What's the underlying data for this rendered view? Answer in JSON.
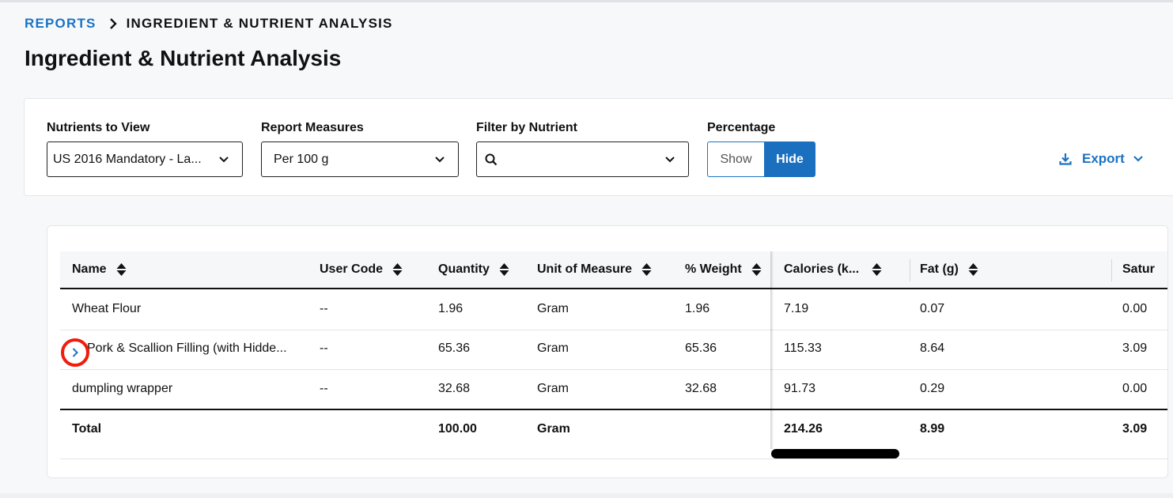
{
  "breadcrumb": {
    "root": "REPORTS",
    "current": "INGREDIENT & NUTRIENT ANALYSIS"
  },
  "page": {
    "title": "Ingredient & Nutrient Analysis"
  },
  "filters": {
    "nutrients_label": "Nutrients to View",
    "nutrients_value": "US 2016 Mandatory - La...",
    "measures_label": "Report Measures",
    "measures_value": "Per 100 g",
    "filter_label": "Filter by Nutrient",
    "filter_value": "",
    "percentage_label": "Percentage",
    "percentage_show": "Show",
    "percentage_hide": "Hide",
    "percentage_selected": "Hide",
    "export_label": "Export"
  },
  "table": {
    "headers": {
      "name": "Name",
      "user_code": "User Code",
      "quantity": "Quantity",
      "unit": "Unit of Measure",
      "weight": "% Weight",
      "calories": "Calories (k...",
      "fat": "Fat (g)",
      "satur": "Satur"
    },
    "rows": [
      {
        "name": "Wheat Flour",
        "user_code": "--",
        "quantity": "1.96",
        "unit": "Gram",
        "weight": "1.96",
        "calories": "7.19",
        "fat": "0.07",
        "satur": "0.00"
      },
      {
        "name": "Pork & Scallion Filling (with Hidde...",
        "user_code": "--",
        "quantity": "65.36",
        "unit": "Gram",
        "weight": "65.36",
        "calories": "115.33",
        "fat": "8.64",
        "satur": "3.09"
      },
      {
        "name": "dumpling wrapper",
        "user_code": "--",
        "quantity": "32.68",
        "unit": "Gram",
        "weight": "32.68",
        "calories": "91.73",
        "fat": "0.29",
        "satur": "0.00"
      }
    ],
    "total": {
      "name": "Total",
      "quantity": "100.00",
      "unit": "Gram",
      "calories": "214.26",
      "fat": "8.99",
      "satur": "3.09"
    }
  },
  "icons": {
    "breadcrumb_separator": "chevron-right-icon",
    "select_chevron": "chevron-down-icon",
    "search": "search-icon",
    "export": "download-icon",
    "sort": "sort-icon",
    "expand_row": "chevron-right-icon"
  },
  "colors": {
    "accent": "#1a73c4",
    "toggle_active": "#1a6fbf",
    "highlight_ring": "#f01c0c"
  }
}
